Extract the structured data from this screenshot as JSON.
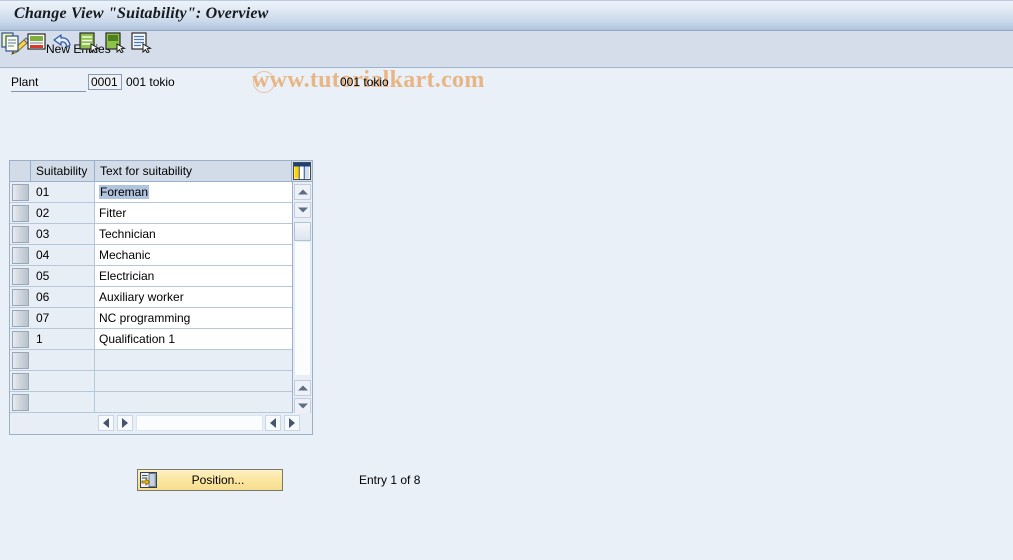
{
  "window": {
    "title": "Change View \"Suitability\": Overview"
  },
  "toolbar": {
    "display_change_icon": "pencil-display-change-icon",
    "new_entries_label": "New Entries",
    "icons": [
      {
        "name": "copy-as-icon",
        "title": "Copy As..."
      },
      {
        "name": "delete-icon",
        "title": "Delete"
      },
      {
        "name": "undo-icon",
        "title": "Undo Change"
      },
      {
        "name": "select-all-icon",
        "title": "Select All"
      },
      {
        "name": "select-block-icon",
        "title": "Select Block"
      },
      {
        "name": "deselect-all-icon",
        "title": "Deselect All"
      }
    ],
    "watermark": "www.tutorialkart.com"
  },
  "plant": {
    "label": "Plant",
    "value": "0001",
    "placeholder": "",
    "description": "001 tokio",
    "description_right": "001 tokio"
  },
  "table": {
    "columns": [
      "Suitability",
      "Text for suitability"
    ],
    "config_icon": "table-settings-icon",
    "rows": [
      {
        "suitability": "01",
        "text": "Foreman",
        "selected": true
      },
      {
        "suitability": "02",
        "text": "Fitter",
        "selected": false
      },
      {
        "suitability": "03",
        "text": "Technician",
        "selected": false
      },
      {
        "suitability": "04",
        "text": "Mechanic",
        "selected": false
      },
      {
        "suitability": "05",
        "text": "Electrician",
        "selected": false
      },
      {
        "suitability": "06",
        "text": "Auxiliary worker",
        "selected": false
      },
      {
        "suitability": "07",
        "text": "NC programming",
        "selected": false
      },
      {
        "suitability": "1",
        "text": "Qualification 1",
        "selected": false
      },
      {
        "suitability": "",
        "text": "",
        "selected": false
      },
      {
        "suitability": "",
        "text": "",
        "selected": false
      },
      {
        "suitability": "",
        "text": "",
        "selected": false
      }
    ]
  },
  "footer": {
    "position_label": "Position...",
    "position_icon": "position-icon",
    "entry_status": "Entry 1 of 8"
  },
  "colors": {
    "page_background": "#eaf0f7",
    "toolbar_background": "#d4dde9",
    "title_gradient_end": "#aec3dd",
    "table_header": "#d2dce8",
    "row_alt": "#e8eef6",
    "selection_highlight": "#b0c4de",
    "button_yellow": "#fbe6a0",
    "watermark": "#e8b584"
  }
}
